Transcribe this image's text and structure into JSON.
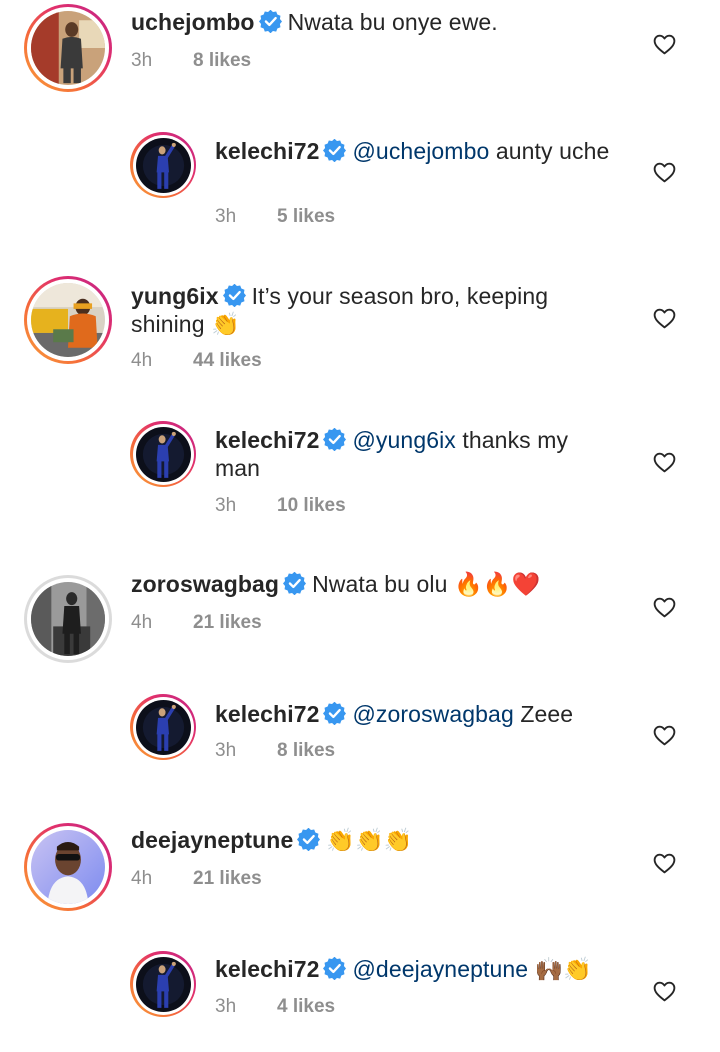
{
  "comments": [
    {
      "type": "top",
      "username": "uchejombo",
      "mention": "",
      "text": "Nwata bu onye ewe.",
      "time": "3h",
      "likes": "8 likes",
      "avatar": "avatar-uchejombo"
    },
    {
      "type": "reply",
      "username": "kelechi72",
      "mention": "@uchejombo",
      "text": " aunty uche",
      "time": "3h",
      "likes": "5 likes",
      "avatar": "avatar-kelechi72"
    },
    {
      "type": "top",
      "username": "yung6ix",
      "mention": "",
      "text": "It’s your season bro, keeping shining 👏",
      "time": "4h",
      "likes": "44 likes",
      "avatar": "avatar-yung6ix"
    },
    {
      "type": "reply",
      "username": "kelechi72",
      "mention": "@yung6ix",
      "text": " thanks my man",
      "time": "3h",
      "likes": "10 likes",
      "avatar": "avatar-kelechi72"
    },
    {
      "type": "top",
      "username": "zoroswagbag",
      "mention": "",
      "text": "Nwata bu olu 🔥🔥❤️",
      "time": "4h",
      "likes": "21 likes",
      "avatar": "avatar-zoroswagbag"
    },
    {
      "type": "reply",
      "username": "kelechi72",
      "mention": "@zoroswagbag",
      "text": " Zeee",
      "time": "3h",
      "likes": "8 likes",
      "avatar": "avatar-kelechi72"
    },
    {
      "type": "top",
      "username": "deejayneptune",
      "mention": "",
      "text": "👏👏👏",
      "time": "4h",
      "likes": "21 likes",
      "avatar": "avatar-deejayneptune"
    },
    {
      "type": "reply",
      "username": "kelechi72",
      "mention": "@deejayneptune",
      "text": " 🙌🏾👏",
      "time": "3h",
      "likes": "4 likes",
      "avatar": "avatar-kelechi72"
    }
  ],
  "icons": {
    "verified": "verified-badge-icon",
    "like": "heart-outline-icon"
  },
  "colors": {
    "verified": "#3897f0",
    "mention": "#00376b",
    "meta": "#8e8e8e",
    "text": "#262626"
  }
}
